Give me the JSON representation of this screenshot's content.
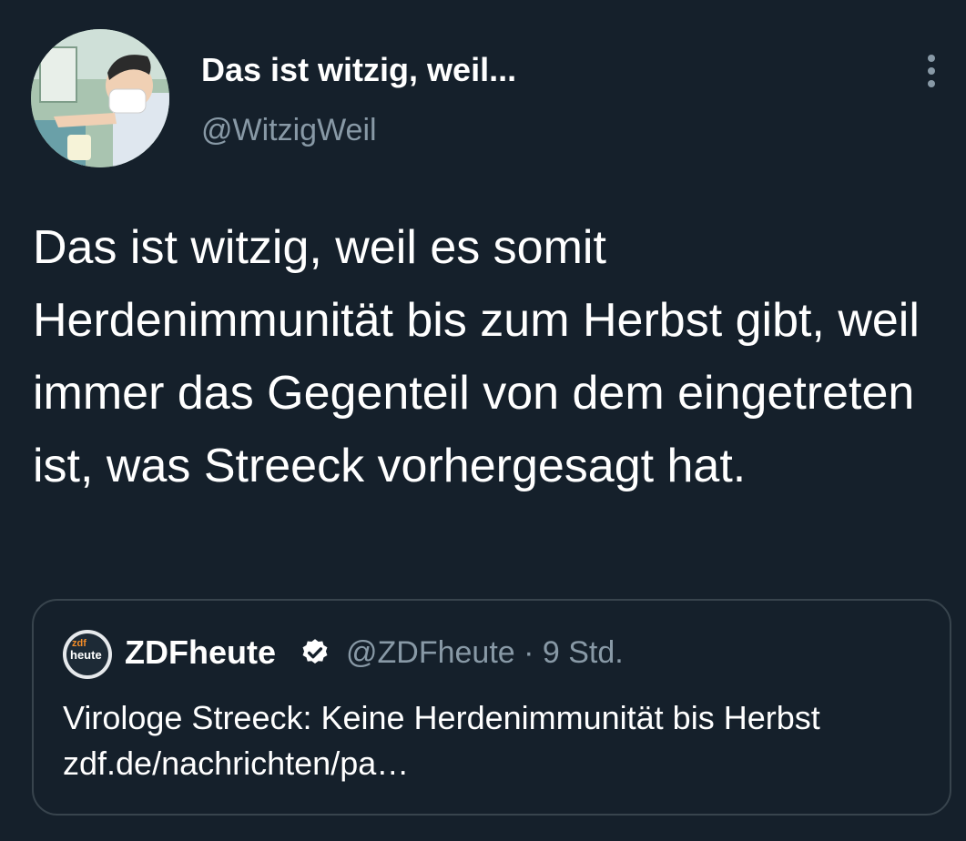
{
  "tweet": {
    "display_name": "Das ist witzig, weil...",
    "handle": "@WitzigWeil",
    "text": "Das ist witzig, weil es somit Herdenimmunität bis zum Herbst gibt, weil immer das Gegenteil von dem eingetreten ist, was Streeck vorhergesagt hat."
  },
  "quoted": {
    "avatar_line1": "zdf",
    "avatar_line2": "heute",
    "display_name": "ZDFheute",
    "meta": "@ZDFheute · 9 Std.",
    "text": "Virologe Streeck: Keine Herdenimmunität bis Herbst zdf.de/nachrichten/pa…"
  },
  "icons": {
    "more": "more-vertical-icon",
    "verified": "verified-badge-icon"
  },
  "colors": {
    "background": "#15202b",
    "secondary_text": "#8899a6",
    "border": "#38444d"
  }
}
